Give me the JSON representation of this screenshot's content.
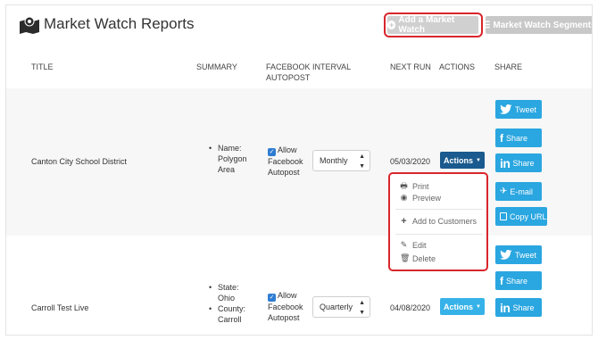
{
  "header": {
    "title": "Market Watch Reports",
    "add_button": "Add a Market Watch",
    "segments_button": "Market Watch Segments"
  },
  "columns": {
    "title": "TITLE",
    "summary": "SUMMARY",
    "facebook_line1": "FACEBOOK",
    "facebook_line2": "AUTOPOST",
    "interval": "INTERVAL",
    "next_run": "NEXT RUN",
    "actions": "ACTIONS",
    "share": "SHARE"
  },
  "rows": [
    {
      "title": "Canton City School District",
      "summary": [
        "Name:",
        "Polygon",
        "Area"
      ],
      "facebook": [
        "Allow",
        "Facebook",
        "Autopost"
      ],
      "interval": "Monthly",
      "next_run": "05/03/2020",
      "actions_label": "Actions"
    },
    {
      "title": "Carroll Test Live",
      "summary_1": [
        "State:",
        "Ohio"
      ],
      "summary_2": [
        "County:",
        "Carroll"
      ],
      "facebook": [
        "Allow",
        "Facebook",
        "Autopost"
      ],
      "interval": "Quarterly",
      "next_run": "04/08/2020",
      "actions_label": "Actions"
    }
  ],
  "share": {
    "tweet": "Tweet",
    "share": "Share",
    "linkedin": "Share",
    "email": "E-mail",
    "copy_url": "Copy URL"
  },
  "dropdown": {
    "print": "Print",
    "preview": "Preview",
    "add_to_customers": "Add to Customers",
    "edit": "Edit",
    "delete": "Delete"
  },
  "colors": {
    "highlight_outline": "#d9262b",
    "share_blue": "#2aa6e0",
    "actions_dark": "#1a5a8e",
    "actions_light": "#36b2e8",
    "checkbox_blue": "#2e7dd3"
  }
}
